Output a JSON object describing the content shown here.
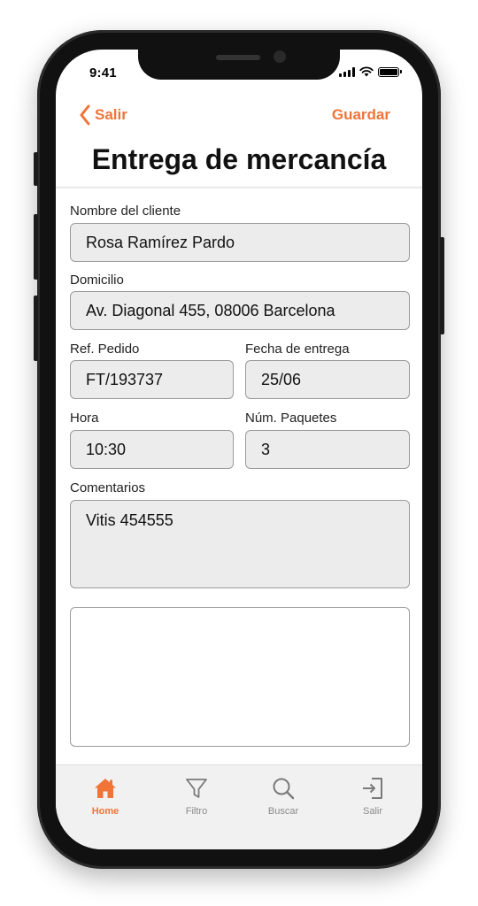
{
  "status_bar": {
    "time": "9:41"
  },
  "nav": {
    "back_label": "Salir",
    "save_label": "Guardar"
  },
  "page": {
    "title": "Entrega de mercancía"
  },
  "form": {
    "customer_name": {
      "label": "Nombre del cliente",
      "value": "Rosa Ramírez Pardo"
    },
    "address": {
      "label": "Domicilio",
      "value": "Av. Diagonal 455, 08006 Barcelona"
    },
    "order_ref": {
      "label": "Ref. Pedido",
      "value": "FT/193737"
    },
    "delivery_date": {
      "label": "Fecha de entrega",
      "value": "25/06"
    },
    "time": {
      "label": "Hora",
      "value": "10:30"
    },
    "packages": {
      "label": "Núm. Paquetes",
      "value": "3"
    },
    "comments": {
      "label": "Comentarios",
      "value": "Vitis 454555"
    }
  },
  "tabbar": {
    "items": [
      {
        "label": "Home",
        "icon": "home-icon",
        "active": true
      },
      {
        "label": "Filtro",
        "icon": "filter-icon",
        "active": false
      },
      {
        "label": "Buscar",
        "icon": "search-icon",
        "active": false
      },
      {
        "label": "Salir",
        "icon": "exit-icon",
        "active": false
      }
    ]
  },
  "colors": {
    "accent": "#f07438",
    "field_bg": "#ececec",
    "tab_inactive": "#8a8a8a"
  }
}
